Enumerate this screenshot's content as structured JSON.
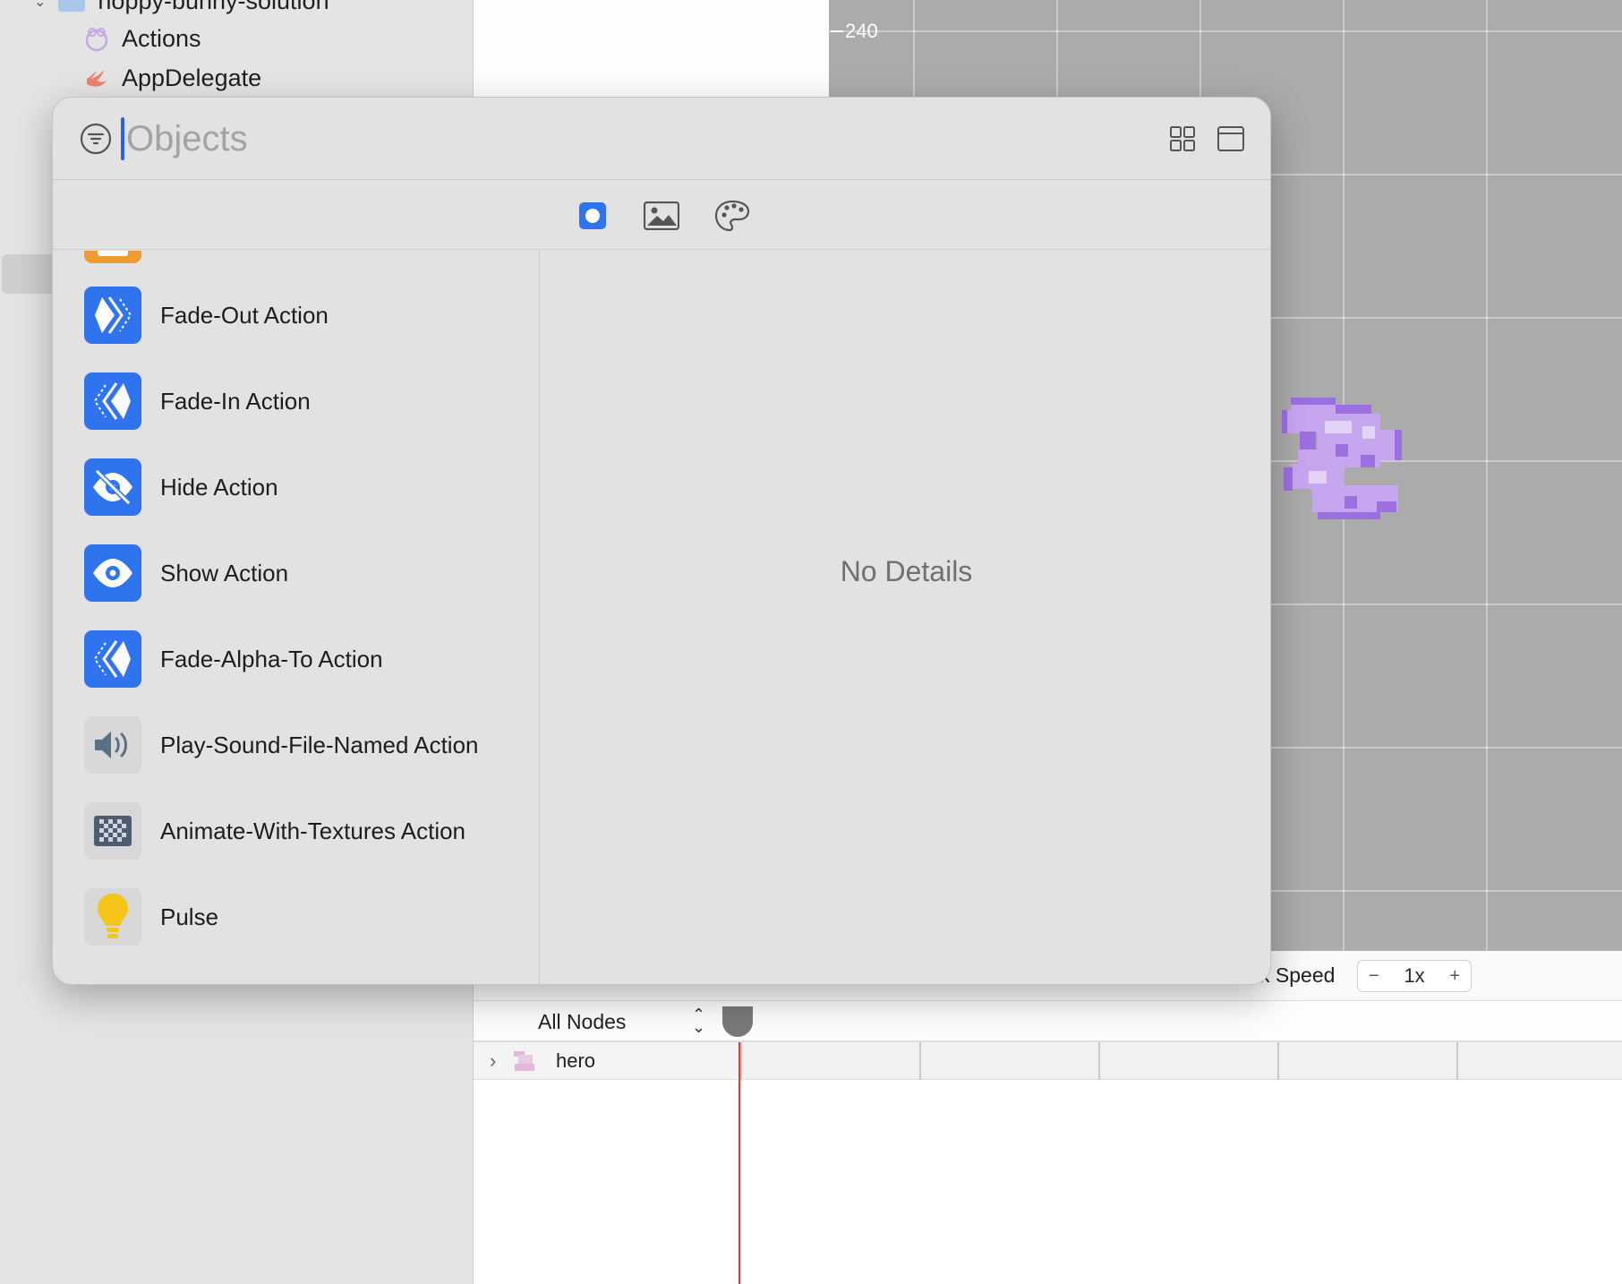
{
  "navigator": {
    "folder_label": "hoppy-bunny-solution",
    "items": [
      {
        "label": "Actions"
      },
      {
        "label": "AppDelegate"
      }
    ]
  },
  "scene": {
    "ruler_label": "240"
  },
  "action_editor": {
    "speed_label": "k Speed",
    "speed_value": "1x",
    "speed_minus": "−",
    "speed_plus": "+",
    "node_filter": "All Nodes",
    "rows": [
      {
        "label": "hero"
      }
    ]
  },
  "library": {
    "search_placeholder": "Objects",
    "tabs": [
      "objects-tab",
      "media-tab",
      "colors-tab"
    ],
    "items": [
      {
        "label": "",
        "icon": "orange-partial-icon"
      },
      {
        "label": "Fade-Out Action",
        "icon": "fade-out-icon"
      },
      {
        "label": "Fade-In Action",
        "icon": "fade-in-icon"
      },
      {
        "label": "Hide Action",
        "icon": "eye-slash-icon"
      },
      {
        "label": "Show Action",
        "icon": "eye-icon"
      },
      {
        "label": "Fade-Alpha-To Action",
        "icon": "fade-alpha-icon"
      },
      {
        "label": "Play-Sound-File-Named Action",
        "icon": "speaker-icon"
      },
      {
        "label": "Animate-With-Textures Action",
        "icon": "checkerboard-icon"
      },
      {
        "label": "Pulse",
        "icon": "lightbulb-icon"
      }
    ],
    "detail_text": "No Details"
  },
  "colors": {
    "accent": "#2f74ee",
    "scene_bg": "#ababab",
    "playhead": "#e03a3a",
    "sprite": "#b48be8"
  }
}
